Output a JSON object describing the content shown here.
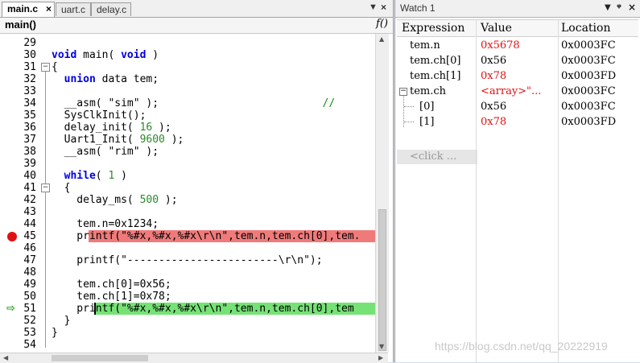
{
  "tabs": [
    {
      "label": "main.c",
      "close": "×"
    },
    {
      "label": "uart.c"
    },
    {
      "label": "delay.c"
    }
  ],
  "tab_nav": {
    "down": "▼",
    "close": "×"
  },
  "func_bar": {
    "name": "main()",
    "icon": "f()"
  },
  "code_lines": [
    {
      "num": "29",
      "text": ""
    },
    {
      "num": "30",
      "text": "void main( void )"
    },
    {
      "num": "31",
      "text": "{"
    },
    {
      "num": "32",
      "text": "  union data tem;"
    },
    {
      "num": "33",
      "text": ""
    },
    {
      "num": "34",
      "text": "  __asm( \"sim\" );                          //"
    },
    {
      "num": "35",
      "text": "  SysClkInit();"
    },
    {
      "num": "36",
      "text": "  delay_init( 16 );"
    },
    {
      "num": "37",
      "text": "  Uart1_Init( 9600 );"
    },
    {
      "num": "38",
      "text": "  __asm( \"rim\" );"
    },
    {
      "num": "39",
      "text": ""
    },
    {
      "num": "40",
      "text": "  while( 1 )"
    },
    {
      "num": "41",
      "text": "  {"
    },
    {
      "num": "42",
      "text": "    delay_ms( 500 );"
    },
    {
      "num": "43",
      "text": ""
    },
    {
      "num": "44",
      "text": "    tem.n=0x1234;"
    },
    {
      "num": "45",
      "text": "    printf(\"%#x,%#x,%#x\\r\\n\",tem.n,tem.ch[0],tem."
    },
    {
      "num": "46",
      "text": ""
    },
    {
      "num": "47",
      "text": "    printf(\"------------------------\\r\\n\");"
    },
    {
      "num": "48",
      "text": ""
    },
    {
      "num": "49",
      "text": "    tem.ch[0]=0x56;"
    },
    {
      "num": "50",
      "text": "    tem.ch[1]=0x78;"
    },
    {
      "num": "51",
      "text": "    printf(\"%#x,%#x,%#x\\r\\n\",tem.n,tem.ch[0],tem"
    },
    {
      "num": "52",
      "text": "  }"
    },
    {
      "num": "53",
      "text": "}"
    },
    {
      "num": "54",
      "text": ""
    }
  ],
  "watch": {
    "title": "Watch 1",
    "controls": {
      "dropdown": "▼",
      "pin": "ᵠ",
      "close": "×"
    },
    "columns": [
      "Expression",
      "Value",
      "Location"
    ],
    "rows": [
      {
        "expr": "tem.n",
        "value": "0x5678",
        "loc": "0x0003FC",
        "changed": true
      },
      {
        "expr": "tem.ch[0]",
        "value": "0x56",
        "loc": "0x0003FC",
        "changed": false
      },
      {
        "expr": "tem.ch[1]",
        "value": "0x78",
        "loc": "0x0003FD",
        "changed": true
      },
      {
        "expr": "tem.ch",
        "value": "<array>\"...",
        "loc": "0x0003FC",
        "changed": true
      },
      {
        "expr": "[0]",
        "value": "0x56",
        "loc": "0x0003FC",
        "changed": false
      },
      {
        "expr": "[1]",
        "value": "0x78",
        "loc": "0x0003FD",
        "changed": true
      }
    ],
    "add_placeholder": "<click ..."
  },
  "watermark": "https://blog.csdn.net/qq_20222919",
  "colors": {
    "breakpoint": "#e01010",
    "current_line": "#76e276",
    "breakpoint_line": "#f07a7a",
    "changed_value": "#e01010"
  }
}
